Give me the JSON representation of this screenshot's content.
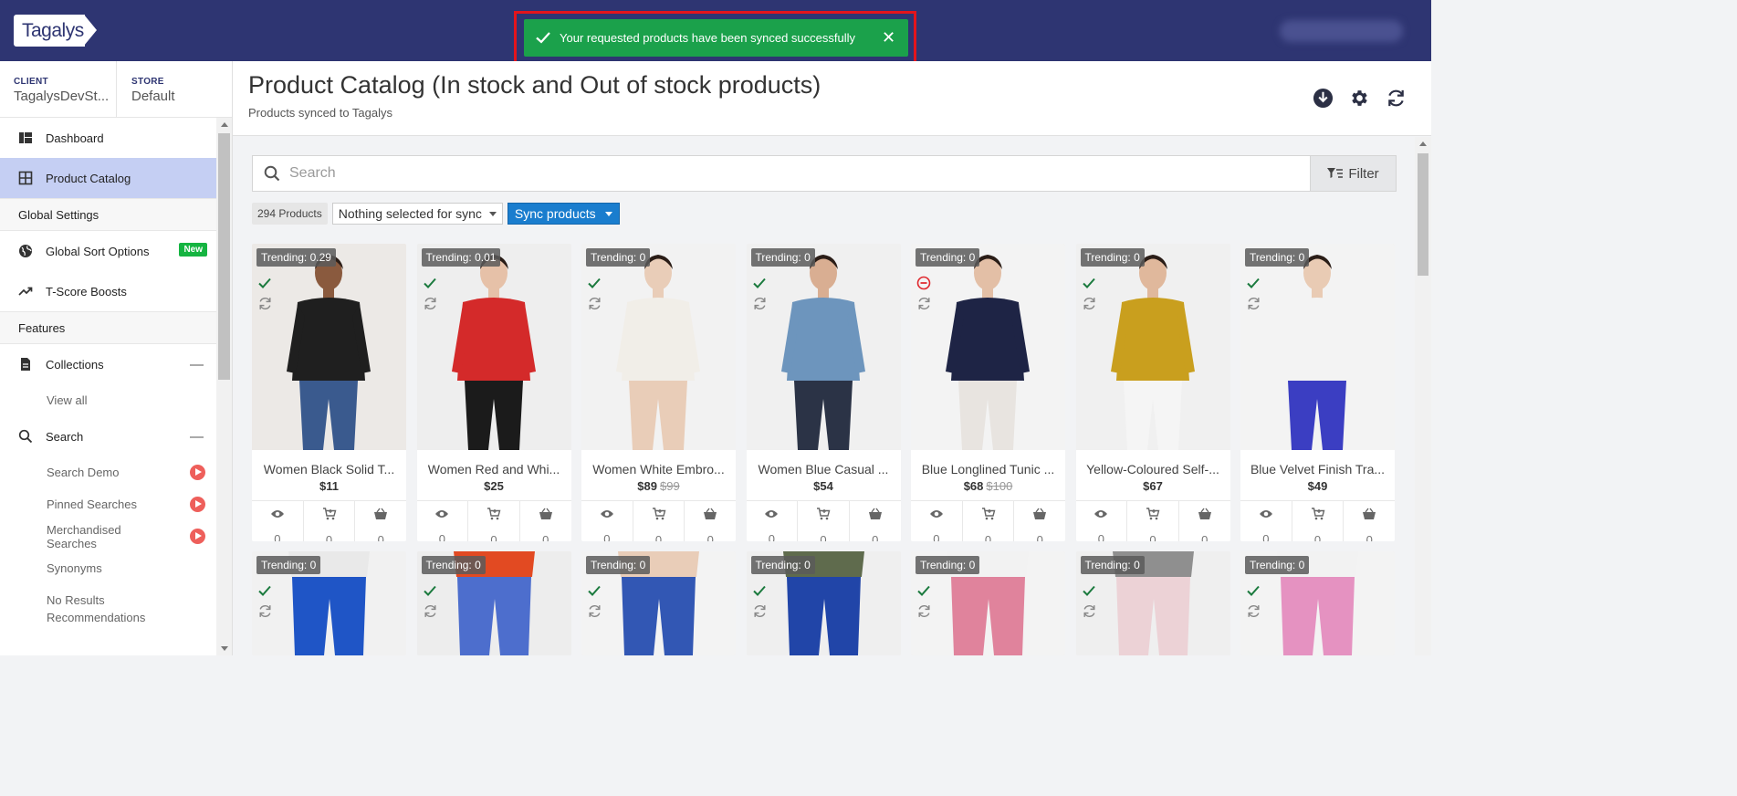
{
  "app": {
    "logo_text": "Tagalys"
  },
  "toast": {
    "message": "Your requested products have been synced successfully",
    "close": "✕"
  },
  "sidebar": {
    "client_label": "CLIENT",
    "client_value": "TagalysDevSt...",
    "store_label": "STORE",
    "store_value": "Default",
    "items": [
      {
        "type": "item",
        "label": "Dashboard",
        "icon": "dashboard-icon"
      },
      {
        "type": "item",
        "label": "Product Catalog",
        "icon": "grid-icon",
        "active": true
      },
      {
        "type": "section",
        "label": "Global Settings"
      },
      {
        "type": "item",
        "label": "Global Sort Options",
        "icon": "globe-icon",
        "badge": "New"
      },
      {
        "type": "item",
        "label": "T-Score Boosts",
        "icon": "trending-icon"
      },
      {
        "type": "section",
        "label": "Features"
      },
      {
        "type": "item",
        "label": "Collections",
        "icon": "file-icon",
        "collapse": "—"
      },
      {
        "type": "sub",
        "label": "View all"
      },
      {
        "type": "item",
        "label": "Search",
        "icon": "search-icon",
        "collapse": "—"
      },
      {
        "type": "sub",
        "label": "Search Demo",
        "play": true
      },
      {
        "type": "sub",
        "label": "Pinned Searches",
        "play": true
      },
      {
        "type": "sub",
        "label": "Merchandised Searches",
        "play": true
      },
      {
        "type": "sub",
        "label": "Synonyms"
      },
      {
        "type": "sub",
        "label": "No Results Recommendations"
      }
    ]
  },
  "header": {
    "title": "Product Catalog (In stock and Out of stock products)",
    "subtitle": "Products synced to Tagalys"
  },
  "search": {
    "placeholder": "Search",
    "value": ""
  },
  "filter_label": "Filter",
  "toolbar": {
    "count": "294 Products",
    "sync_select": "Nothing selected for sync",
    "sync_button": "Sync products"
  },
  "colors": {
    "topbar": "#2e3572",
    "toast": "#1ba14b",
    "accent": "#1a7dce",
    "active_item": "#c5cff3",
    "badge": "#15b441"
  },
  "products": [
    {
      "trending": "Trending: 0.29",
      "status": "synced",
      "name": "Women Black Solid T...",
      "price": "$11",
      "old_price": "",
      "views": "0",
      "add_to_cart": "0",
      "buys": "0",
      "garment": "#1f1f1f",
      "pants": "#3a5a8e",
      "skin": "#8a5a3e",
      "bg": "#ece9e6"
    },
    {
      "trending": "Trending: 0.01",
      "status": "synced",
      "name": "Women Red and Whi...",
      "price": "$25",
      "old_price": "",
      "views": "0",
      "add_to_cart": "0",
      "buys": "0",
      "garment": "#d42a2a",
      "pants": "#1b1b1b",
      "skin": "#e6c1a8",
      "bg": "#eeeeee"
    },
    {
      "trending": "Trending: 0",
      "status": "synced",
      "name": "Women White Embro...",
      "price": "$89",
      "old_price": "$99",
      "views": "0",
      "add_to_cart": "0",
      "buys": "0",
      "garment": "#f1eee8",
      "pants": "#e9cdb8",
      "skin": "#e9cdb8",
      "bg": "#f2f2f2"
    },
    {
      "trending": "Trending: 0",
      "status": "synced",
      "name": "Women Blue Casual ...",
      "price": "$54",
      "old_price": "",
      "views": "0",
      "add_to_cart": "0",
      "buys": "0",
      "garment": "#6d95bd",
      "pants": "#2b3346",
      "skin": "#d9ae92",
      "bg": "#f0f0f0"
    },
    {
      "trending": "Trending: 0",
      "status": "not-synced",
      "name": "Blue Longlined Tunic ...",
      "price": "$68",
      "old_price": "$100",
      "views": "0",
      "add_to_cart": "0",
      "buys": "0",
      "garment": "#1e2445",
      "pants": "#e8e4e0",
      "skin": "#e3bfa6",
      "bg": "#f3f3f3"
    },
    {
      "trending": "Trending: 0",
      "status": "synced",
      "name": "Yellow-Coloured Self-...",
      "price": "$67",
      "old_price": "",
      "views": "0",
      "add_to_cart": "0",
      "buys": "0",
      "garment": "#c99f1e",
      "pants": "#f5f5f5",
      "skin": "#e0b89c",
      "bg": "#f0f0f0"
    },
    {
      "trending": "Trending: 0",
      "status": "synced",
      "name": "Blue Velvet Finish Tra...",
      "price": "$49",
      "old_price": "",
      "views": "0",
      "add_to_cart": "0",
      "buys": "0",
      "garment": "#f3f3f3",
      "pants": "#3b3ec2",
      "skin": "#e9cbb4",
      "bg": "#f3f3f3"
    },
    {
      "trending": "Trending: 0",
      "status": "synced",
      "garment": "#e9e9e9",
      "pants": "#1f55c6",
      "bg": "#f1f1f1"
    },
    {
      "trending": "Trending: 0",
      "status": "synced",
      "garment": "#e24a22",
      "pants": "#4d6ecd",
      "bg": "#ededed"
    },
    {
      "trending": "Trending: 0",
      "status": "synced",
      "garment": "#e9cdb8",
      "pants": "#3257b4",
      "bg": "#f3f3f3"
    },
    {
      "trending": "Trending: 0",
      "status": "synced",
      "garment": "#5f6b4d",
      "pants": "#2145a8",
      "bg": "#efefef"
    },
    {
      "trending": "Trending: 0",
      "status": "synced",
      "garment": "#f2f2f2",
      "pants": "#e0839c",
      "bg": "#f3f3f3"
    },
    {
      "trending": "Trending: 0",
      "status": "synced",
      "garment": "#8f8f8f",
      "pants": "#ecd2d6",
      "bg": "#efefef"
    },
    {
      "trending": "Trending: 0",
      "status": "synced",
      "garment": "#f2f2f2",
      "pants": "#e592c1",
      "bg": "#f3f3f3"
    }
  ]
}
